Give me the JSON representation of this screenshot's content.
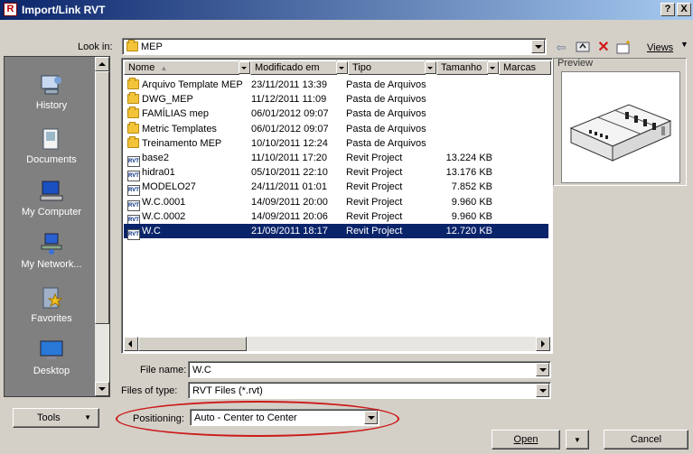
{
  "window": {
    "title": "Import/Link RVT",
    "app_icon": "R",
    "help_label": "?",
    "close_label": "X"
  },
  "look_in": {
    "label": "Look in:",
    "value": "MEP",
    "icon": "folder-icon"
  },
  "toolbar": {
    "back_icon": "back-arrow-icon",
    "up_folder_icon": "up-folder-icon",
    "delete_icon": "delete-icon",
    "new_folder_icon": "new-folder-icon",
    "views_label": "Views",
    "views_icon": "chevron-down-icon"
  },
  "places": [
    {
      "label": "History",
      "icon": "history-icon"
    },
    {
      "label": "Documents",
      "icon": "documents-icon"
    },
    {
      "label": "My Computer",
      "icon": "computer-icon"
    },
    {
      "label": "My Network...",
      "icon": "network-icon"
    },
    {
      "label": "Favorites",
      "icon": "favorites-icon"
    },
    {
      "label": "Desktop",
      "icon": "desktop-icon"
    }
  ],
  "file_list": {
    "columns": [
      "Nome",
      "Modificado em",
      "Tipo",
      "Tamanho",
      "Marcas"
    ],
    "sort_indicator": "▲",
    "rows": [
      {
        "name": "Arquivo Template MEP",
        "date": "23/11/2011 13:39",
        "type": "Pasta de Arquivos",
        "size": "",
        "icon": "folder",
        "selected": false
      },
      {
        "name": "DWG_MEP",
        "date": "11/12/2011 11:09",
        "type": "Pasta de Arquivos",
        "size": "",
        "icon": "folder",
        "selected": false
      },
      {
        "name": "FAMÍLIAS mep",
        "date": "06/01/2012 09:07",
        "type": "Pasta de Arquivos",
        "size": "",
        "icon": "folder",
        "selected": false
      },
      {
        "name": "Metric Templates",
        "date": "06/01/2012 09:07",
        "type": "Pasta de Arquivos",
        "size": "",
        "icon": "folder",
        "selected": false
      },
      {
        "name": "Treinamento MEP",
        "date": "10/10/2011 12:24",
        "type": "Pasta de Arquivos",
        "size": "",
        "icon": "folder",
        "selected": false
      },
      {
        "name": "base2",
        "date": "11/10/2011 17:20",
        "type": "Revit Project",
        "size": "13.224 KB",
        "icon": "rvt",
        "selected": false
      },
      {
        "name": "hidra01",
        "date": "05/10/2011 22:10",
        "type": "Revit Project",
        "size": "13.176 KB",
        "icon": "rvt",
        "selected": false
      },
      {
        "name": "MODELO27",
        "date": "24/11/2011 01:01",
        "type": "Revit Project",
        "size": "7.852 KB",
        "icon": "rvt",
        "selected": false
      },
      {
        "name": "W.C.0001",
        "date": "14/09/2011 20:00",
        "type": "Revit Project",
        "size": "9.960 KB",
        "icon": "rvt",
        "selected": false
      },
      {
        "name": "W.C.0002",
        "date": "14/09/2011 20:06",
        "type": "Revit Project",
        "size": "9.960 KB",
        "icon": "rvt",
        "selected": false
      },
      {
        "name": "W.C",
        "date": "21/09/2011 18:17",
        "type": "Revit Project",
        "size": "12.720 KB",
        "icon": "rvt",
        "selected": true
      }
    ],
    "rvt_badge": "RVT"
  },
  "preview": {
    "label": "Preview"
  },
  "file_name": {
    "label": "File name:",
    "value": "W.C"
  },
  "files_of_type": {
    "label": "Files of type:",
    "value": "RVT Files  (*.rvt)"
  },
  "positioning": {
    "label": "Positioning:",
    "value": "Auto - Center to Center"
  },
  "buttons": {
    "tools": "Tools",
    "open": "Open",
    "cancel": "Cancel"
  },
  "colors": {
    "selection": "#0a246a",
    "annotation": "#cc1a1a",
    "dialog": "#d4d0c8"
  }
}
